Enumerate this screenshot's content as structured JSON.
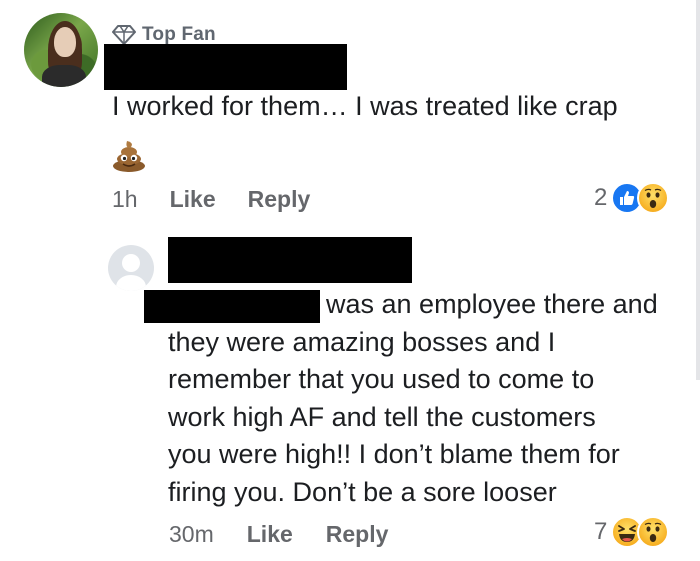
{
  "comment1": {
    "badge": "Top Fan",
    "text": "I worked for them… I was treated like crap",
    "emoji_attachment": "pile-of-poo",
    "time": "1h",
    "like_label": "Like",
    "reply_label": "Reply",
    "reaction_count": "2",
    "reactions": [
      "like",
      "wow"
    ]
  },
  "comment2": {
    "lines": [
      "was an employee there and",
      "they were amazing bosses and I",
      "remember that you used to come to",
      "work high AF and tell the customers",
      "you were high!! I don’t blame them for",
      "firing you.  Don’t be a sore looser"
    ],
    "time": "30m",
    "like_label": "Like",
    "reply_label": "Reply",
    "reaction_count": "7",
    "reactions": [
      "haha",
      "wow"
    ]
  },
  "colors": {
    "like_blue": "#1877f2",
    "meta_gray": "#65676b",
    "text": "#1c1e21",
    "redaction": "#000000"
  }
}
